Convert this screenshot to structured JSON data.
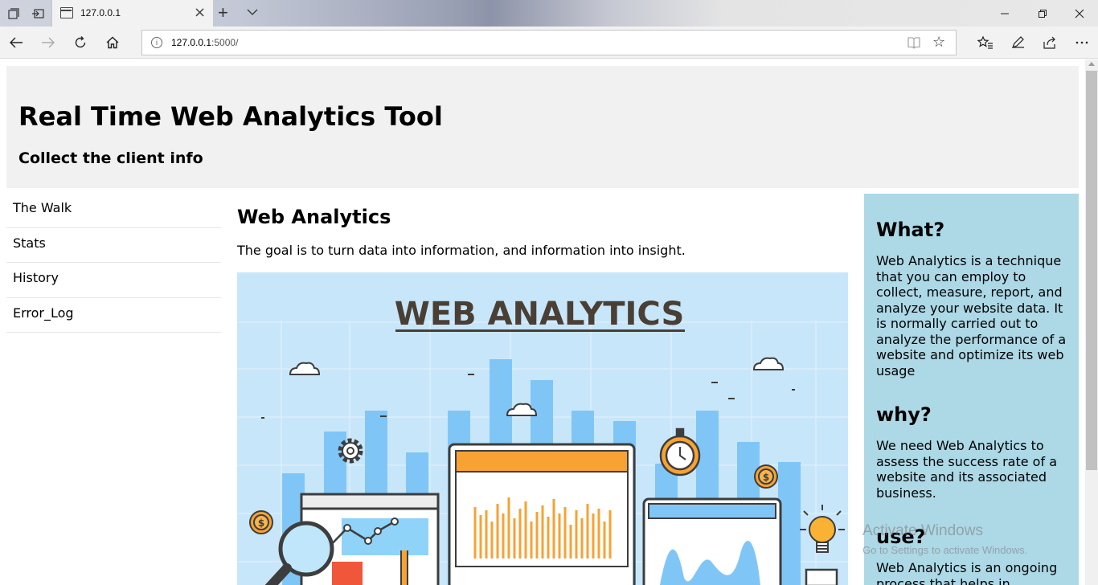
{
  "browser": {
    "tab_title": "127.0.0.1",
    "url_host": "127.0.0.1",
    "url_rest": ":5000/",
    "info_glyph": "i"
  },
  "header": {
    "title": "Real Time Web Analytics Tool",
    "subtitle": "Collect the client info"
  },
  "menu": {
    "items": [
      {
        "label": "The Walk"
      },
      {
        "label": "Stats"
      },
      {
        "label": "History"
      },
      {
        "label": "Error_Log"
      }
    ]
  },
  "main": {
    "heading": "Web Analytics",
    "intro": "The goal is to turn data into information, and information into insight.",
    "banner_text": "WEB ANALYTICS"
  },
  "aside": {
    "what_heading": "What?",
    "what_text": "Web Analytics is a technique that you can employ to collect, measure, report, and analyze your website data. It is normally carried out to analyze the performance of a website and optimize its web usage",
    "why_heading": "why?",
    "why_text": "We need Web Analytics to assess the success rate of a website and its associated business.",
    "use_heading": "use?",
    "use_text": "Web Analytics is an ongoing process that helps in"
  },
  "watermark": {
    "line1": "Activate Windows",
    "line2": "Go to Settings to activate Windows."
  },
  "colors": {
    "header_bg": "#f1f1f1",
    "aside_bg": "#add8e6",
    "illustration_bg": "#c8e6fa"
  }
}
